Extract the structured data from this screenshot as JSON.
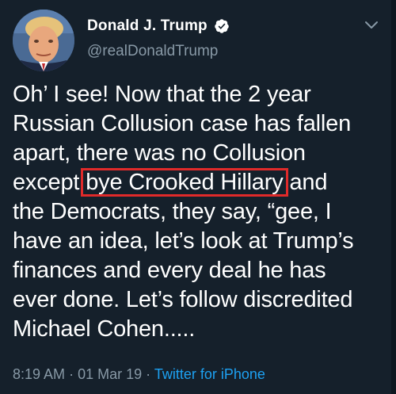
{
  "tweet": {
    "display_name": "Donald J. Trump",
    "handle": "@realDonaldTrump",
    "verified": true,
    "body_lines": [
      "Oh’ I see! Now that the 2 year",
      "Russian Collusion case has fallen",
      "apart, there was no Collusion",
      "the Democrats, they say, “gee, I",
      "have an idea, let’s look at Trump’s",
      "finances and every deal he has",
      "ever done. Let’s follow discredited",
      "Michael Cohen....."
    ],
    "line4_before": "except",
    "highlighted_text": "bye Crooked Hillary",
    "line4_after": "and",
    "time": "8:19 AM",
    "separator": "·",
    "date": "01 Mar 19",
    "source": "Twitter for iPhone"
  },
  "colors": {
    "background": "#15202b",
    "text": "#ffffff",
    "secondary": "#8899a6",
    "link": "#1da1f2",
    "highlight_border": "#e02a2a"
  },
  "icons": {
    "verified": "verified-badge-icon",
    "menu": "chevron-down-icon"
  }
}
